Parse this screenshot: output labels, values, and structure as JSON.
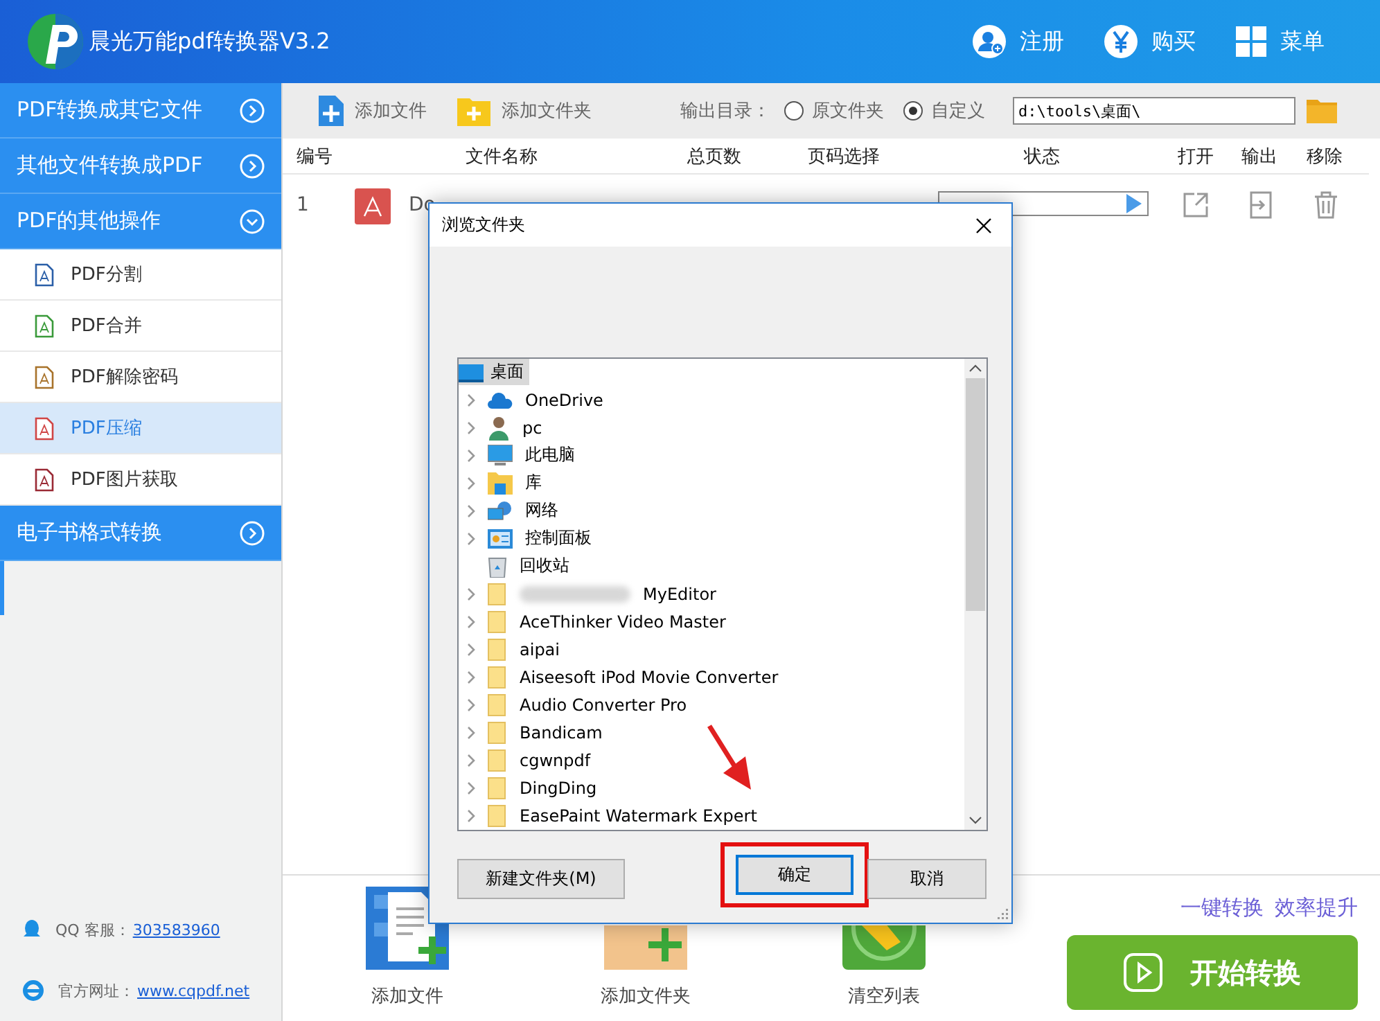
{
  "app": {
    "title": "晨光万能pdf转换器V3.2",
    "header_buttons": [
      {
        "label": "注册",
        "kind": "user"
      },
      {
        "label": "购买",
        "kind": "yen"
      },
      {
        "label": "菜单",
        "kind": "grid"
      }
    ]
  },
  "sidebar": {
    "sections": [
      {
        "label": "PDF转换成其它文件",
        "expanded": false
      },
      {
        "label": "其他文件转换成PDF",
        "expanded": false
      },
      {
        "label": "PDF的其他操作",
        "expanded": true,
        "items": [
          {
            "label": "PDF分割",
            "color": "#2b5fa8",
            "selected": false
          },
          {
            "label": "PDF合并",
            "color": "#3a9a3a",
            "selected": false
          },
          {
            "label": "PDF解除密码",
            "color": "#a8732b",
            "selected": false
          },
          {
            "label": "PDF压缩",
            "color": "#d04545",
            "selected": true
          },
          {
            "label": "PDF图片获取",
            "color": "#9a2a35",
            "selected": false
          }
        ]
      },
      {
        "label": "电子书格式转换",
        "expanded": false
      }
    ],
    "contact": [
      {
        "label": "QQ 客服：",
        "link": "303583960",
        "kind": "qq"
      },
      {
        "label": "官方网址：",
        "link": "www.cqpdf.net",
        "kind": "ie"
      }
    ]
  },
  "toolbar": {
    "add_file": "添加文件",
    "add_folder": "添加文件夹",
    "output_label": "输出目录：",
    "options": [
      {
        "label": "原文件夹",
        "selected": false
      },
      {
        "label": "自定义",
        "selected": true
      }
    ],
    "path": "d:\\tools\\桌面\\"
  },
  "table": {
    "columns": [
      "编号",
      "文件名称",
      "总页数",
      "页码选择",
      "状态",
      "打开",
      "输出",
      "移除"
    ],
    "rows": [
      {
        "number": "1",
        "name": "Do"
      }
    ]
  },
  "bottom": {
    "actions": [
      {
        "label": "添加文件",
        "kind": "file"
      },
      {
        "label": "添加文件夹",
        "kind": "folder"
      },
      {
        "label": "清空列表",
        "kind": "broom"
      }
    ],
    "slogan": [
      "一键转换",
      "效率提升"
    ],
    "start": "开始转换"
  },
  "dialog": {
    "title": "浏览文件夹",
    "tree": [
      {
        "label": "桌面",
        "kind": "desktop",
        "selected": true,
        "children": [
          {
            "label": "OneDrive",
            "kind": "cloud",
            "expandable": true
          },
          {
            "label": "pc",
            "kind": "user",
            "expandable": true
          },
          {
            "label": "此电脑",
            "kind": "computer",
            "expandable": true
          },
          {
            "label": "库",
            "kind": "library",
            "expandable": true
          },
          {
            "label": "网络",
            "kind": "network",
            "expandable": true
          },
          {
            "label": "控制面板",
            "kind": "control",
            "expandable": true
          },
          {
            "label": "回收站",
            "kind": "recycle",
            "expandable": false
          },
          {
            "label": "MyEditor",
            "kind": "folder",
            "expandable": true,
            "blurred": true
          },
          {
            "label": "AceThinker Video Master",
            "kind": "folder",
            "expandable": true
          },
          {
            "label": "aipai",
            "kind": "folder",
            "expandable": true
          },
          {
            "label": "Aiseesoft iPod Movie Converter",
            "kind": "folder",
            "expandable": true
          },
          {
            "label": "Audio Converter Pro",
            "kind": "folder",
            "expandable": true
          },
          {
            "label": "Bandicam",
            "kind": "folder",
            "expandable": true
          },
          {
            "label": "cgwnpdf",
            "kind": "folder",
            "expandable": true
          },
          {
            "label": "DingDing",
            "kind": "folder",
            "expandable": true
          },
          {
            "label": "EasePaint Watermark Expert",
            "kind": "folder",
            "expandable": true
          }
        ]
      }
    ],
    "buttons": [
      {
        "label": "新建文件夹(M)",
        "focused": false,
        "highlighted": false
      },
      {
        "label": "确定",
        "focused": true,
        "highlighted": true
      },
      {
        "label": "取消",
        "focused": false,
        "highlighted": false
      }
    ]
  }
}
